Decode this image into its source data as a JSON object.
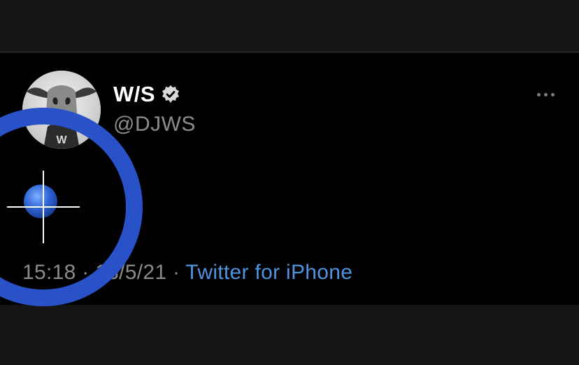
{
  "tweet": {
    "display_name": "W/S",
    "handle": "@DJWS",
    "time": "15:18",
    "separator": "·",
    "date": "13/5/21",
    "source": "Twitter for iPhone"
  },
  "icons": {
    "verified": "verified-badge-icon",
    "more": "more-options-icon",
    "touch_indicator": "touch-indicator-icon"
  },
  "colors": {
    "background": "#151515",
    "card": "#000000",
    "name": "#ffffff",
    "muted": "#8b8b8b",
    "link": "#4e94e0",
    "touch_ring": "#2a52c8"
  }
}
